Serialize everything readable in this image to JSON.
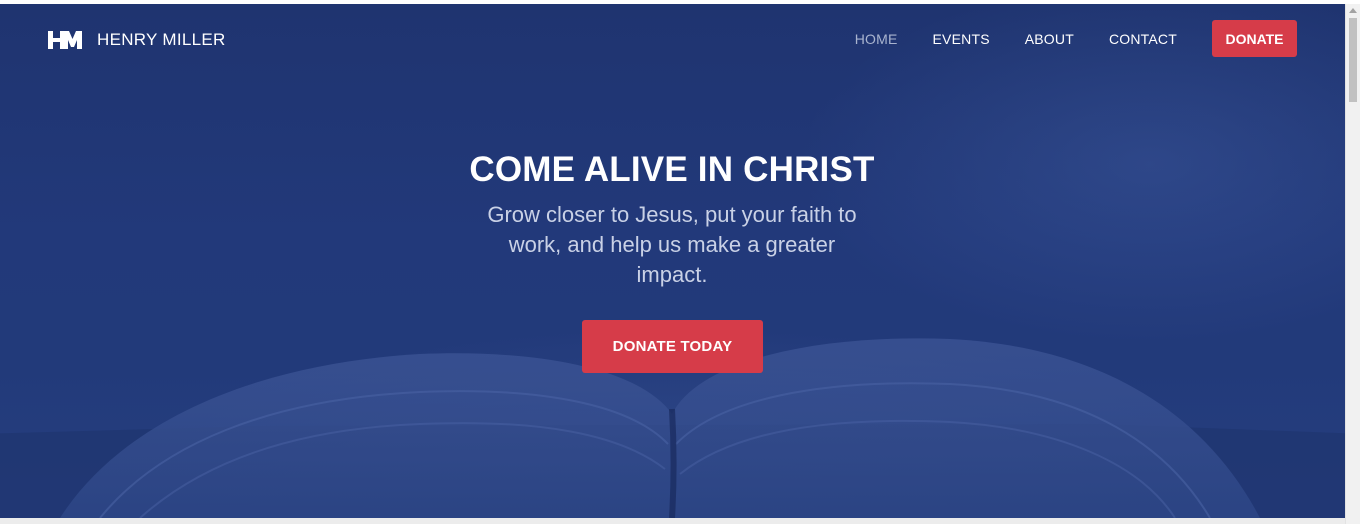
{
  "brand": {
    "name": "HENRY MILLER",
    "logo_icon": "hm-monogram-icon"
  },
  "nav": {
    "items": [
      {
        "label": "HOME",
        "active": true
      },
      {
        "label": "EVENTS",
        "active": false
      },
      {
        "label": "ABOUT",
        "active": false
      },
      {
        "label": "CONTACT",
        "active": false
      }
    ],
    "donate_label": "DONATE"
  },
  "hero": {
    "title": "COME ALIVE IN CHRIST",
    "subtitle": "Grow closer to Jesus, put your faith to work, and help us make a greater impact.",
    "cta_label": "DONATE TODAY"
  },
  "colors": {
    "background_blue": "#22397a",
    "accent_red": "#d63c49",
    "text_white": "#ffffff",
    "nav_active": "#a9b4cf"
  }
}
